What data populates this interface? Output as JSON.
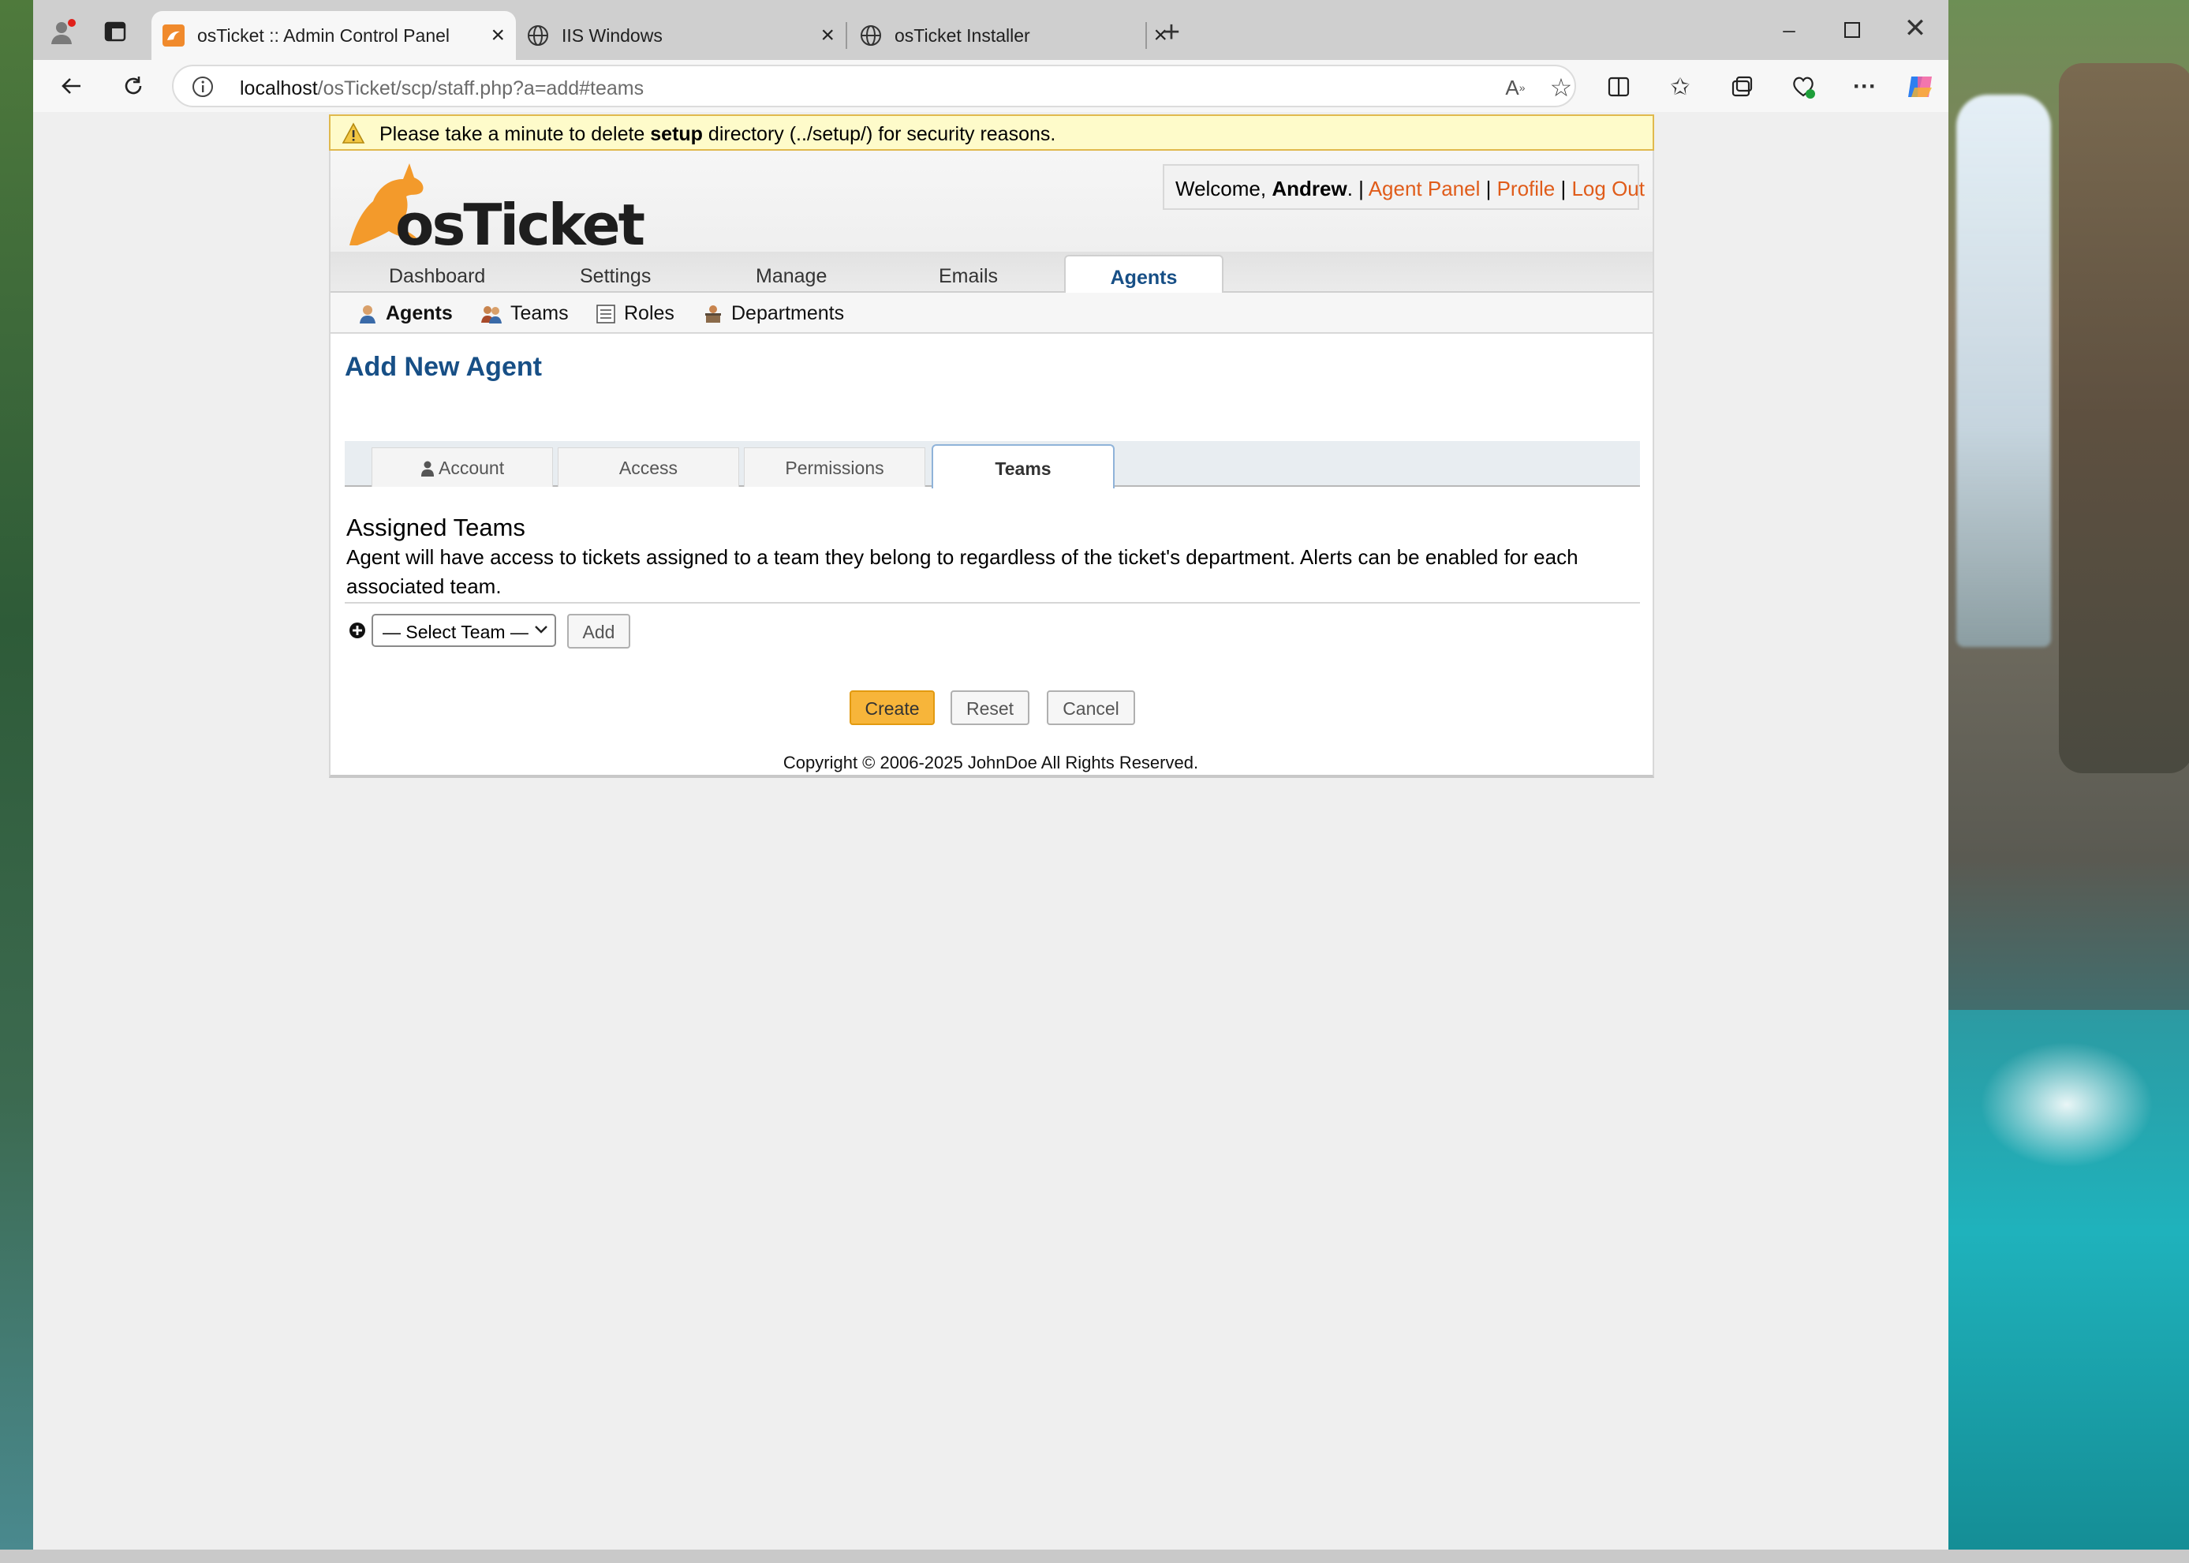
{
  "browser": {
    "tabs": [
      {
        "title": "osTicket :: Admin Control Panel",
        "active": true,
        "icon": "osticket-favicon"
      },
      {
        "title": "IIS Windows",
        "active": false,
        "icon": "globe-icon"
      },
      {
        "title": "osTicket Installer",
        "active": false,
        "icon": "globe-icon"
      }
    ],
    "url_host": "localhost",
    "url_path": "/osTicket/scp/staff.php?a=add#teams"
  },
  "warning": {
    "prefix": "Please take a minute to delete ",
    "bold": "setup",
    "suffix": " directory (../setup/) for security reasons."
  },
  "header": {
    "logo_text": "osTicket",
    "welcome_prefix": "Welcome, ",
    "user": "Andrew",
    "welcome_suffix": ". | ",
    "links": [
      "Agent Panel",
      "Profile",
      "Log Out"
    ],
    "sep": " | "
  },
  "nav": {
    "items": [
      "Dashboard",
      "Settings",
      "Manage",
      "Emails",
      "Agents"
    ],
    "active": "Agents"
  },
  "subnav": {
    "items": [
      "Agents",
      "Teams",
      "Roles",
      "Departments"
    ],
    "active": "Agents"
  },
  "page": {
    "title": "Add New Agent",
    "tabs": [
      "Account",
      "Access",
      "Permissions",
      "Teams"
    ],
    "active_tab": "Teams",
    "section_title": "Assigned Teams",
    "section_desc": "Agent will have access to tickets assigned to a team they belong to regardless of the ticket's department. Alerts can be enabled for each associated team.",
    "select_value": "— Select Team —",
    "add_label": "Add",
    "buttons": {
      "create": "Create",
      "reset": "Reset",
      "cancel": "Cancel"
    }
  },
  "footer": {
    "copyright": "Copyright © 2006-2025 JohnDoe All Rights Reserved."
  },
  "colors": {
    "accent": "#174f86",
    "link": "#e05c1a",
    "primary_button": "#f7b53a",
    "warning_bg": "#fefbca"
  }
}
